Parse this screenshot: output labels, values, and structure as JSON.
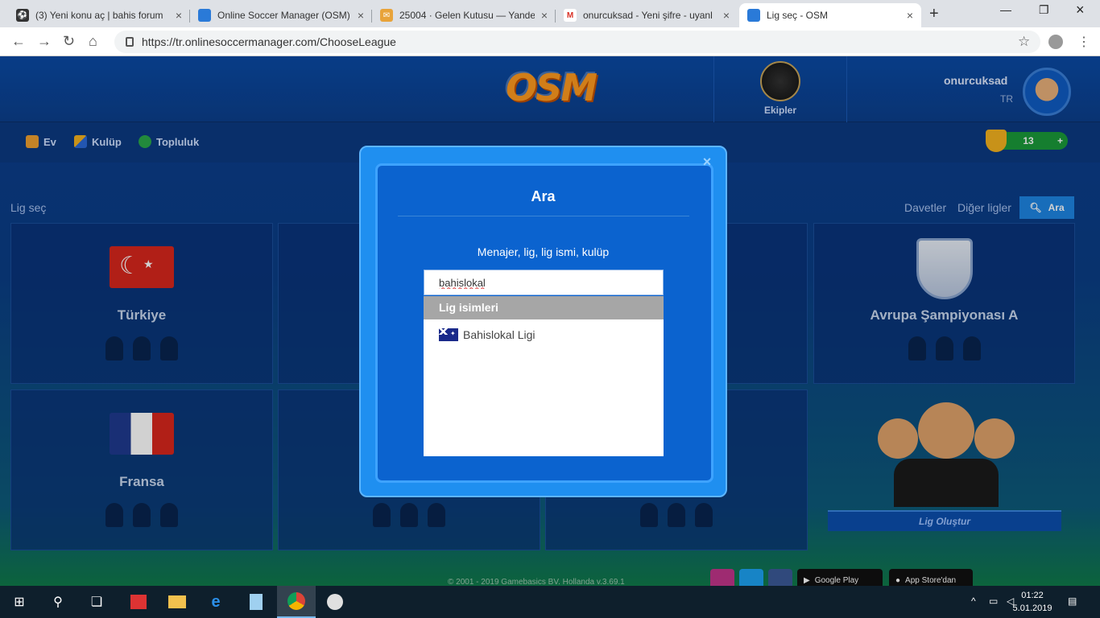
{
  "browser": {
    "tabs": [
      {
        "title": "(3) Yeni konu aç | bahis forum",
        "color": "#333333"
      },
      {
        "title": "Online Soccer Manager (OSM)",
        "color": "#2a7ad8"
      },
      {
        "title": "25004 · Gelen Kutusu — Yande",
        "color": "#e8a33a"
      },
      {
        "title": "onurcuksad - Yeni şifre - uyanl",
        "color": "#d93025"
      },
      {
        "title": "Lig seç - OSM",
        "color": "#2a7ad8"
      }
    ],
    "url": "https://tr.onlinesoccermanager.com/ChooseLeague"
  },
  "header": {
    "logo": "OSM",
    "teams_label": "Ekipler",
    "username": "onurcuksad",
    "country": "TR"
  },
  "nav": {
    "home": "Ev",
    "club": "Kulüp",
    "community": "Topluluk",
    "coins": "13",
    "plus": "+"
  },
  "section": {
    "title": "Lig seç",
    "invites": "Davetler",
    "other_leagues": "Diğer ligler",
    "search": "Ara"
  },
  "leagues": [
    {
      "name": "Türkiye"
    },
    {
      "name": "Avrupa Şampiyonası A"
    },
    {
      "name": "Fransa"
    }
  ],
  "create_league": "Lig Oluştur",
  "footer": {
    "copyright": "© 2001 - 2019 Gamebasics BV. Hollanda v.3.69.1",
    "google_play": "Google Play",
    "app_store": "App Store'dan"
  },
  "modal": {
    "title": "Ara",
    "hint": "Menajer, lig, lig ismi, kulüp",
    "search_value": "bahislokal",
    "section_header": "Lig isimleri",
    "results": [
      {
        "name": "Bahislokal Ligi",
        "flag": "australia-flag-icon"
      }
    ]
  },
  "taskbar": {
    "time": "01:22",
    "date": "5.01.2019"
  }
}
